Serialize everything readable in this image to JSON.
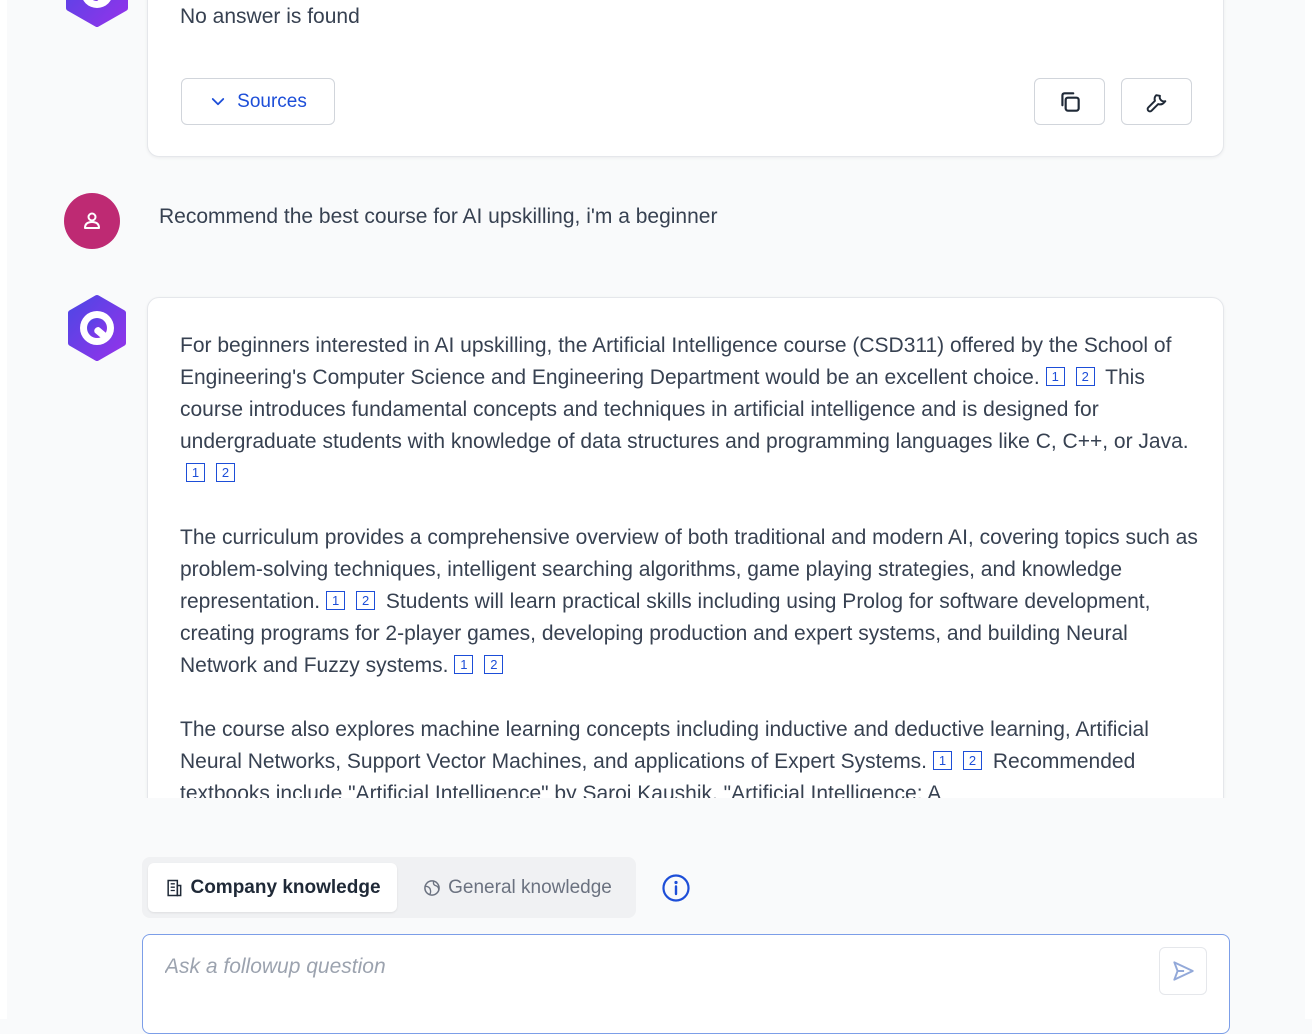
{
  "messages": {
    "previous_answer": {
      "text": "No answer is found",
      "sources_label": "Sources"
    },
    "user_question": "Recommend the best course for AI upskilling, i'm a beginner",
    "answer": {
      "paragraphs": [
        [
          {
            "t": "For beginners interested in AI upskilling, the Artificial Intelligence course (CSD311) offered by the School of Engineering's Computer Science and Engineering Department would be an excellent choice."
          },
          {
            "c": "1"
          },
          {
            "c": "2"
          },
          {
            "t": " This course introduces fundamental concepts and techniques in artificial intelligence and is designed for undergraduate students with knowledge of data structures and programming languages like C, C++, or Java."
          },
          {
            "c": "1"
          },
          {
            "c": "2"
          }
        ],
        [
          {
            "t": "The curriculum provides a comprehensive overview of both traditional and modern AI, covering topics such as problem-solving techniques, intelligent searching algorithms, game playing strategies, and knowledge representation."
          },
          {
            "c": "1"
          },
          {
            "c": "2"
          },
          {
            "t": " Students will learn practical skills including using Prolog for software development, creating programs for 2-player games, developing production and expert systems, and building Neural Network and Fuzzy systems."
          },
          {
            "c": "1"
          },
          {
            "c": "2"
          }
        ],
        [
          {
            "t": "The course also explores machine learning concepts including inductive and deductive learning, Artificial Neural Networks, Support Vector Machines, and applications of Expert Systems."
          },
          {
            "c": "1"
          },
          {
            "c": "2"
          },
          {
            "t": " Recommended textbooks include \"Artificial Intelligence\" by Saroj Kaushik, \"Artificial Intelligence: A"
          }
        ]
      ]
    }
  },
  "mode_toggle": {
    "company_label": "Company knowledge",
    "general_label": "General knowledge",
    "selected": "company"
  },
  "input": {
    "placeholder": "Ask a followup question",
    "value": ""
  },
  "colors": {
    "accent": "#1d4ed8",
    "user_avatar": "#be2a73",
    "bot_avatar_gradient": [
      "#4f46e5",
      "#9333ea"
    ]
  },
  "icons": {
    "sources_toggle": "chevron-down-icon",
    "copy": "copy-icon",
    "tools": "wrench-icon",
    "user": "user-icon",
    "company_mode": "building-icon",
    "general_mode": "globe-icon",
    "info": "info-icon",
    "send": "send-icon"
  }
}
